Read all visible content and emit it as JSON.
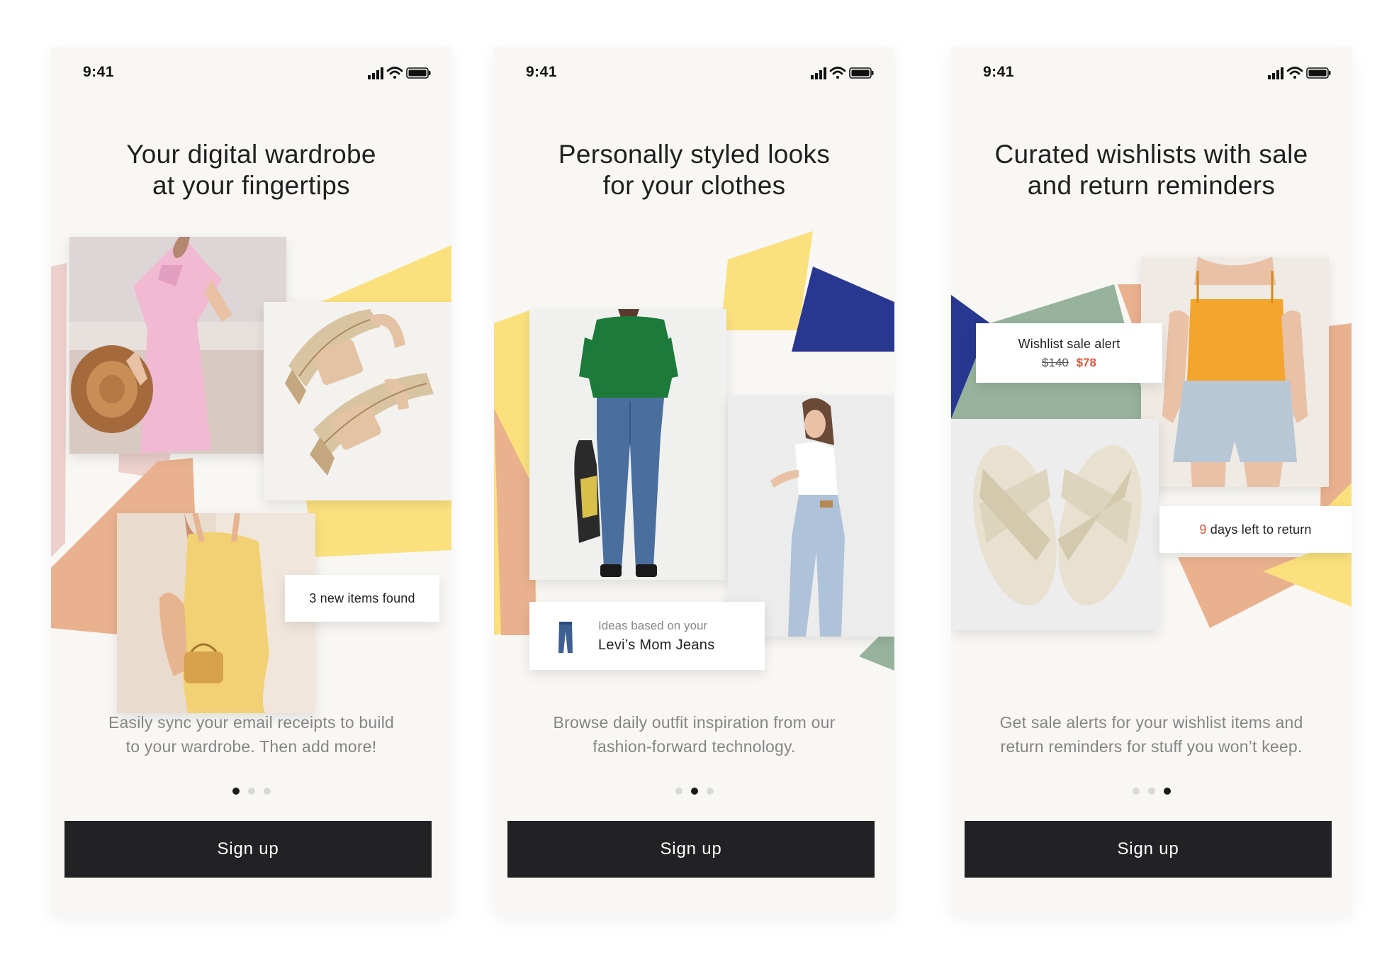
{
  "screens": [
    {
      "status_time": "9:41",
      "headline": [
        "Your digital wardrobe",
        "at your fingertips"
      ],
      "badge": "3 new items found",
      "description": [
        "Easily sync your email receipts to build",
        "to your wardrobe. Then add more!"
      ],
      "page_index": 1,
      "page_count": 3,
      "signup_label": "Sign up"
    },
    {
      "status_time": "9:41",
      "headline": [
        "Personally styled looks",
        "for your clothes"
      ],
      "ideas_caption": "Ideas based on your",
      "ideas_item": "Levi’s Mom Jeans",
      "description": [
        "Browse daily outfit inspiration from our",
        "fashion-forward technology."
      ],
      "page_index": 2,
      "page_count": 3,
      "signup_label": "Sign up"
    },
    {
      "status_time": "9:41",
      "headline": [
        "Curated wishlists with sale",
        "and return reminders"
      ],
      "sale_title": "Wishlist sale alert",
      "old_price": "$140",
      "new_price": "$78",
      "return_days": "9",
      "return_text": " days left to return",
      "description": [
        "Get sale alerts for your wishlist items and",
        "return reminders for stuff you won’t keep."
      ],
      "page_index": 3,
      "page_count": 3,
      "signup_label": "Sign up"
    }
  ],
  "colors": {
    "screen_bg": "#f8f7f4",
    "button": "#222224",
    "yellow": "#fbe17d",
    "peach": "#eab18e",
    "blush": "#ecd0cc",
    "navy": "#283890",
    "sage": "#97b39d",
    "sale_red": "#e2553b"
  },
  "icons": [
    "signal-icon",
    "wifi-icon",
    "battery-icon",
    "jeans-icon"
  ]
}
